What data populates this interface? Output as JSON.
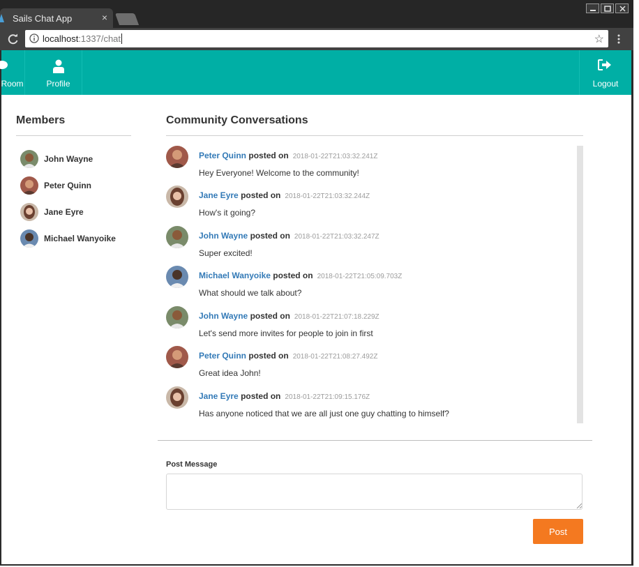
{
  "browser": {
    "tab_title": "Sails Chat App",
    "tab_close": "×",
    "url_host": "localhost",
    "url_path": ":1337/chat",
    "star": "☆"
  },
  "nav": {
    "room_label": "Room",
    "profile_label": "Profile",
    "logout_label": "Logout",
    "bg_color": "#00afa5"
  },
  "members": {
    "title": "Members",
    "items": [
      {
        "name": "John Wayne"
      },
      {
        "name": "Peter Quinn"
      },
      {
        "name": "Jane Eyre"
      },
      {
        "name": "Michael Wanyoike"
      }
    ]
  },
  "conversation": {
    "title": "Community Conversations",
    "posted_on": "posted on",
    "messages": [
      {
        "author": "Peter Quinn",
        "timestamp": "2018-01-22T21:03:32.241Z",
        "text": "Hey Everyone! Welcome to the community!"
      },
      {
        "author": "Jane Eyre",
        "timestamp": "2018-01-22T21:03:32.244Z",
        "text": "How's it going?"
      },
      {
        "author": "John Wayne",
        "timestamp": "2018-01-22T21:03:32.247Z",
        "text": "Super excited!"
      },
      {
        "author": "Michael Wanyoike",
        "timestamp": "2018-01-22T21:05:09.703Z",
        "text": "What should we talk about?"
      },
      {
        "author": "John Wayne",
        "timestamp": "2018-01-22T21:07:18.229Z",
        "text": "Let's send more invites for people to join in first"
      },
      {
        "author": "Peter Quinn",
        "timestamp": "2018-01-22T21:08:27.492Z",
        "text": "Great idea John!"
      },
      {
        "author": "Jane Eyre",
        "timestamp": "2018-01-22T21:09:15.176Z",
        "text": "Has anyone noticed that we are all just one guy chatting to himself?"
      }
    ]
  },
  "post": {
    "label": "Post Message",
    "value": "",
    "button_label": "Post",
    "button_color": "#f47920"
  }
}
